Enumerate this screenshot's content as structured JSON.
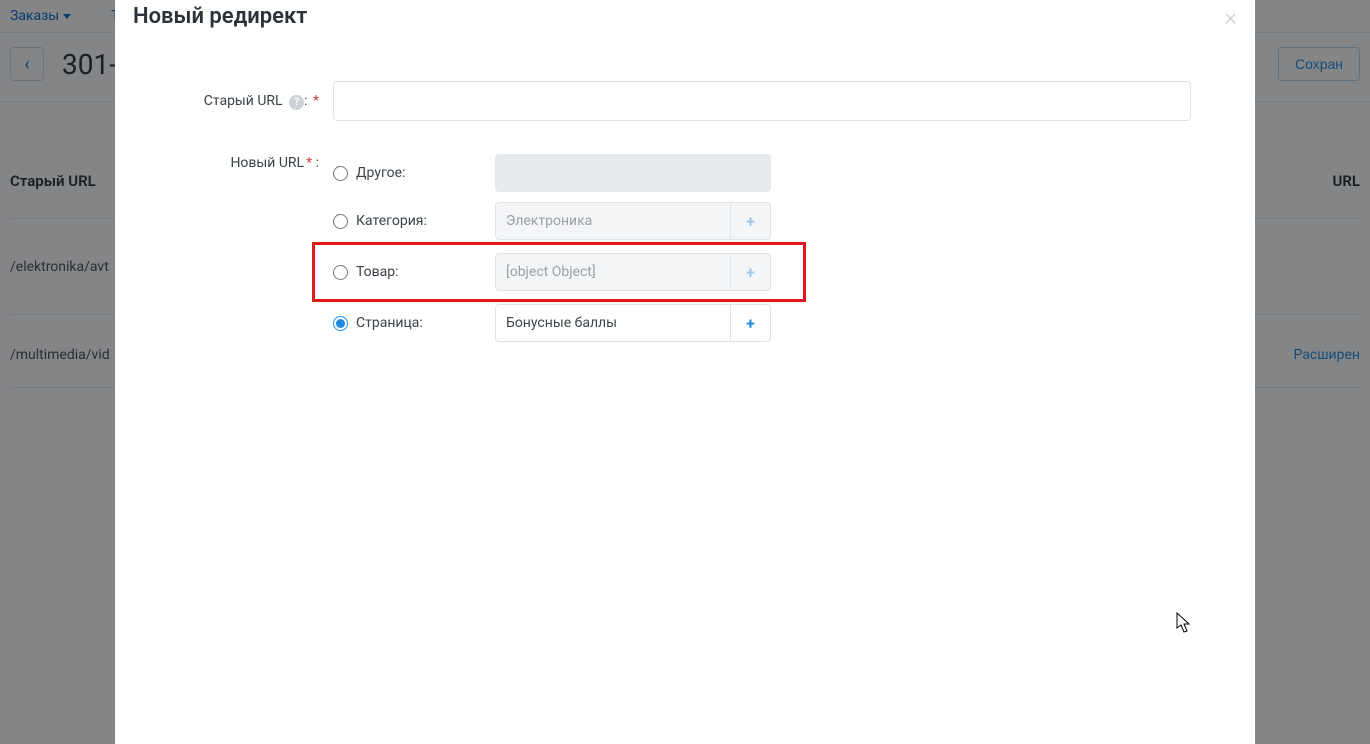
{
  "bg": {
    "nav": {
      "orders": "Заказы",
      "products": "То"
    },
    "page_title": "301-ре",
    "save_btn": "Сохран",
    "th_old": "Старый URL",
    "th_new": "URL",
    "row1": "/elektronika/avt",
    "row2": "/multimedia/vid",
    "advanced": "Расширен"
  },
  "modal": {
    "title": "Новый редирект",
    "old_url_label": "Старый URL",
    "new_url_label": "Новый URL",
    "options": {
      "other": "Другое:",
      "category": "Категория:",
      "product": "Товар:",
      "page": "Страница:"
    },
    "values": {
      "category": "Электроника",
      "product": "[object Object]",
      "page": "Бонусные баллы"
    }
  }
}
